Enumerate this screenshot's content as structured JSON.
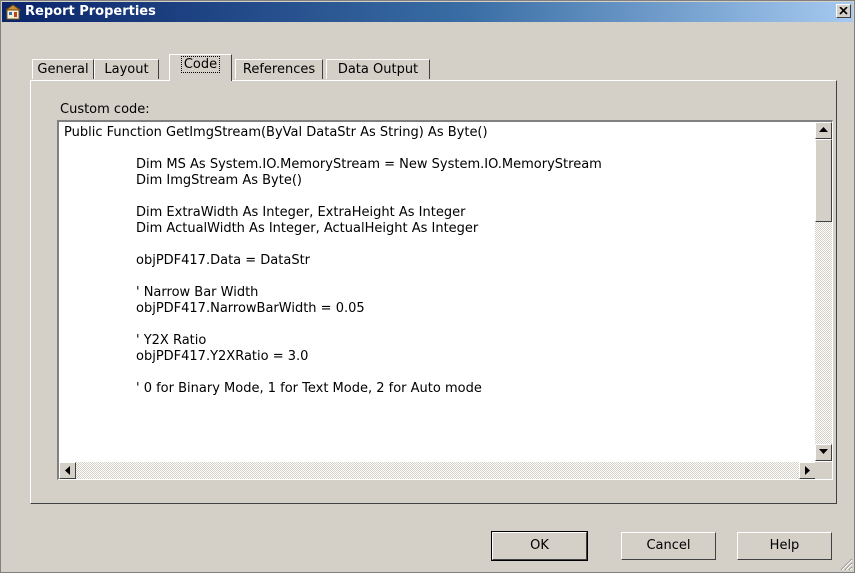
{
  "window": {
    "title": "Report Properties",
    "close_label": "x"
  },
  "tabs": [
    {
      "label": "General"
    },
    {
      "label": "Layout"
    },
    {
      "label": "Code"
    },
    {
      "label": "References"
    },
    {
      "label": "Data Output"
    }
  ],
  "active_tab": "Code",
  "code_panel": {
    "label": "Custom code:",
    "lines": [
      "Public Function GetImgStream(ByVal DataStr As String) As Byte()",
      "",
      "Dim MS As System.IO.MemoryStream = New System.IO.MemoryStream",
      "Dim ImgStream As Byte()",
      "",
      "Dim ExtraWidth As Integer, ExtraHeight As Integer",
      "Dim ActualWidth As Integer, ActualHeight As Integer",
      "",
      "objPDF417.Data = DataStr",
      "",
      "' Narrow Bar Width",
      "objPDF417.NarrowBarWidth = 0.05",
      "",
      "' Y2X Ratio",
      "objPDF417.Y2XRatio = 3.0",
      "",
      "' 0 for Binary Mode, 1 for Text Mode, 2 for Auto mode"
    ]
  },
  "buttons": {
    "ok": "OK",
    "cancel": "Cancel",
    "help": "Help"
  },
  "icons": {
    "window_icon": "report-properties-icon",
    "close": "close-icon",
    "scroll_up": "arrow-up-icon",
    "scroll_down": "arrow-down-icon",
    "scroll_left": "arrow-left-icon",
    "scroll_right": "arrow-right-icon",
    "grip": "resize-grip-icon"
  },
  "colors": {
    "titlebar_start": "#0a246a",
    "titlebar_end": "#a6caf0",
    "face": "#d4d0c8"
  }
}
